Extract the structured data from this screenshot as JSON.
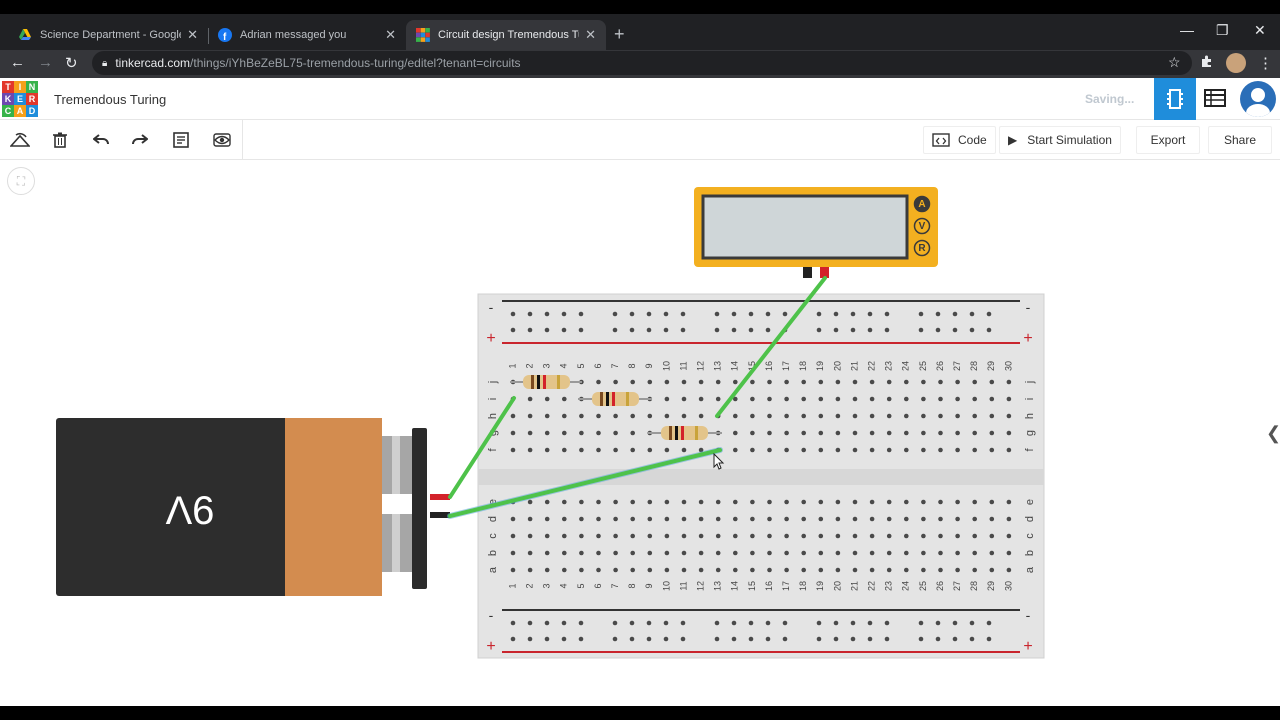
{
  "browser": {
    "tabs": [
      {
        "title": "Science Department - Google Dr",
        "icon": "google-drive-icon"
      },
      {
        "title": "Adrian messaged you",
        "icon": "facebook-icon"
      },
      {
        "title": "Circuit design Tremendous Turing",
        "icon": "tinkercad-icon"
      }
    ],
    "url_host": "tinkercad.com",
    "url_path": "/things/iYhBeZeBL75-tremendous-turing/editel?tenant=circuits"
  },
  "app": {
    "logo_letters": [
      "T",
      "I",
      "N",
      "K",
      "E",
      "R",
      "C",
      "A",
      "D"
    ],
    "design_name": "Tremendous Turing",
    "save_status": "Saving..."
  },
  "toolbar": {
    "code_label": "Code",
    "simulate_label": "Start Simulation",
    "export_label": "Export",
    "share_label": "Share"
  },
  "battery": {
    "label": "9V"
  },
  "multimeter": {
    "modes": [
      "A",
      "V",
      "R"
    ]
  },
  "breadboard": {
    "columns": [
      "1",
      "2",
      "3",
      "4",
      "5",
      "6",
      "7",
      "8",
      "9",
      "10",
      "11",
      "12",
      "13",
      "14",
      "15",
      "16",
      "17",
      "18",
      "19",
      "20",
      "21",
      "22",
      "23",
      "24",
      "25",
      "26",
      "27",
      "28",
      "29",
      "30"
    ],
    "top_rows": [
      "j",
      "i",
      "h",
      "g",
      "f"
    ],
    "bottom_rows": [
      "e",
      "d",
      "c",
      "b",
      "a"
    ],
    "rail_minus": "-",
    "rail_plus": "+"
  },
  "colors": {
    "tab_bg": "#202124",
    "accent": "#1f8ddb",
    "wire": "#4ec24a",
    "battery_body": "#2d2d2d",
    "battery_cap": "#d38c4f",
    "meter": "#f3b020"
  }
}
